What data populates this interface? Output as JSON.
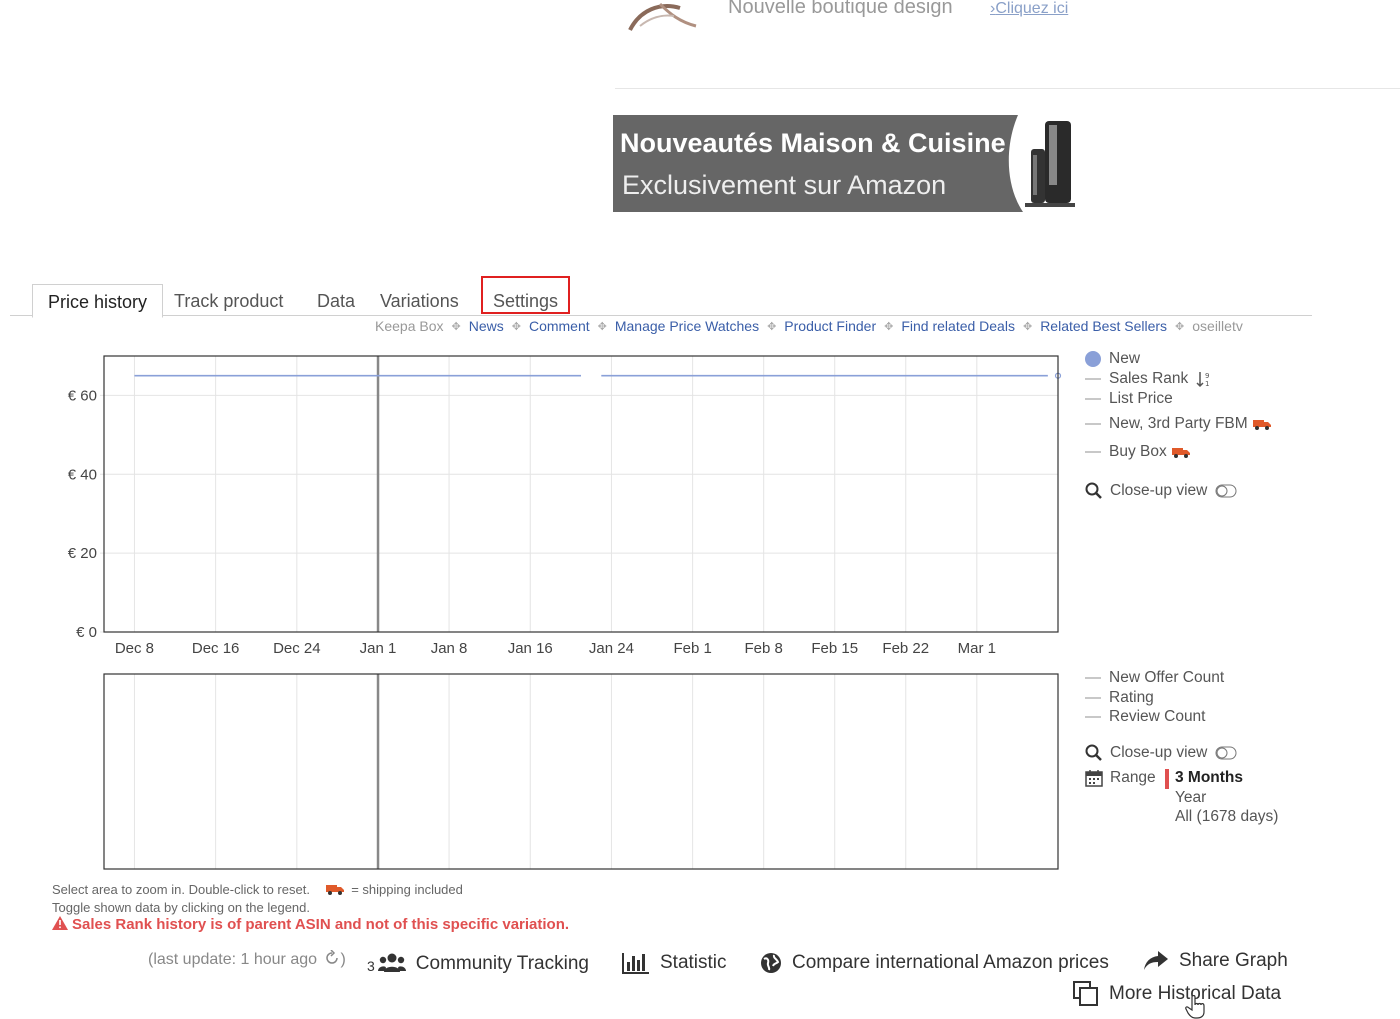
{
  "top_promo": {
    "text": "Nouvelle boutique design",
    "link": "Cliquez ici",
    "link_prefix": "›"
  },
  "banner": {
    "title": "Nouveautés Maison & Cuisine",
    "subtitle": "Exclusivement sur Amazon"
  },
  "tabs": [
    {
      "label": "Price history",
      "active": true
    },
    {
      "label": "Track product"
    },
    {
      "label": "Data"
    },
    {
      "label": "Variations"
    },
    {
      "label": "Settings",
      "highlighted": true
    }
  ],
  "links": [
    {
      "label": "Keepa Box",
      "muted": true
    },
    {
      "label": "News"
    },
    {
      "label": "Comment"
    },
    {
      "label": "Manage Price Watches"
    },
    {
      "label": "Product Finder"
    },
    {
      "label": "Find related Deals"
    },
    {
      "label": "Related Best Sellers"
    },
    {
      "label": "oseilletv",
      "muted": true
    }
  ],
  "chart_data": [
    {
      "type": "line",
      "x_tick_labels": [
        "Dec 8",
        "Dec 16",
        "Dec 24",
        "Jan 1",
        "Jan 8",
        "Jan 16",
        "Jan 24",
        "Feb 1",
        "Feb 8",
        "Feb 15",
        "Feb 22",
        "Mar 1"
      ],
      "y_tick_labels": [
        "€ 0",
        "€ 20",
        "€ 40",
        "€ 60"
      ],
      "y_ticks": [
        0,
        20,
        40,
        60
      ],
      "ylim": [
        0,
        70
      ],
      "grid": true,
      "series": [
        {
          "name": "New",
          "color": "#8aa0d8",
          "segments": [
            {
              "x_from": "Dec 8",
              "x_to": "Jan 21",
              "y": 65
            },
            {
              "x_from": "Jan 23",
              "x_to": "Mar 8",
              "y": 65
            }
          ]
        }
      ]
    }
  ],
  "legend_main": {
    "new": "New",
    "sales_rank": "Sales Rank",
    "list_price": "List Price",
    "third_party": "New, 3rd Party FBM",
    "buy_box": "Buy Box",
    "closeup": "Close-up view"
  },
  "legend_sub": {
    "offer_count": "New Offer Count",
    "rating": "Rating",
    "review_count": "Review Count",
    "closeup": "Close-up view",
    "range_label": "Range",
    "range_options": [
      "3 Months",
      "Year",
      "All (1678 days)"
    ],
    "range_selected": "3 Months"
  },
  "notes": {
    "zoom": "Select area to zoom in. Double-click to reset.",
    "shipping": "= shipping included",
    "toggle": "Toggle shown data by clicking on the legend.",
    "warning": "Sales Rank history is of parent ASIN and not of this specific variation."
  },
  "footer": {
    "last_update": "(last update: 1 hour ago",
    "last_update_end": ")",
    "community_count": "3",
    "community": "Community Tracking",
    "statistic": "Statistic",
    "compare": "Compare international Amazon prices",
    "share": "Share Graph",
    "more": "More Historical Data"
  },
  "colors": {
    "accent": "#3a5ea8",
    "warning": "#e05050",
    "highlight_border": "#e02020",
    "series_new": "#8aa0d8"
  }
}
